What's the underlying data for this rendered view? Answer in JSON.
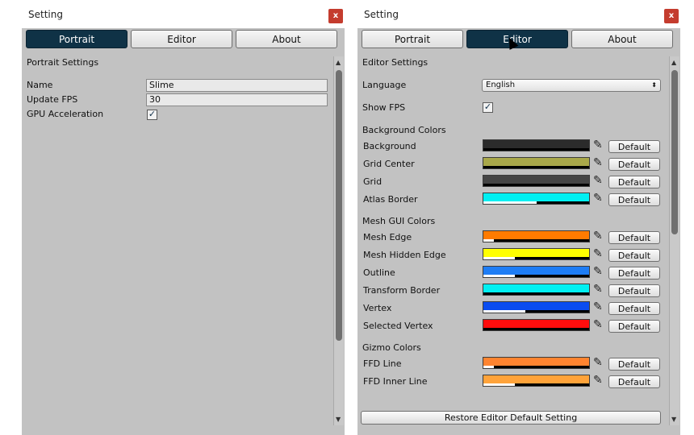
{
  "left": {
    "title": "Setting",
    "close": "x",
    "tabs": [
      "Portrait",
      "Editor",
      "About"
    ],
    "active_tab": "Portrait",
    "section": "Portrait Settings",
    "fields": {
      "name_label": "Name",
      "name_value": "Slime",
      "fps_label": "Update FPS",
      "fps_value": "30",
      "gpu_label": "GPU Acceleration",
      "gpu_checked": true
    },
    "scroll_arrow_up": "▲",
    "scroll_arrow_down": "▼"
  },
  "right": {
    "title": "Setting",
    "close": "x",
    "tabs": [
      "Portrait",
      "Editor",
      "About"
    ],
    "active_tab": "Editor",
    "section": "Editor Settings",
    "language_label": "Language",
    "language_value": "English",
    "show_fps_label": "Show FPS",
    "show_fps_checked": true,
    "bg_group": "Background Colors",
    "mesh_group": "Mesh GUI Colors",
    "gizmo_group": "Gizmo Colors",
    "default_label": "Default",
    "picker_glyph": "✎",
    "colors": [
      {
        "label": "Background",
        "color": "#2b2b2b",
        "alpha": 1.0
      },
      {
        "label": "Grid Center",
        "color": "#a9a84a",
        "alpha": 1.0
      },
      {
        "label": "Grid",
        "color": "#454545",
        "alpha": 1.0
      },
      {
        "label": "Atlas Border",
        "color": "#00f0f2",
        "alpha": 0.5
      },
      {
        "label": "Mesh Edge",
        "color": "#ff7b00",
        "alpha": 0.9
      },
      {
        "label": "Mesh Hidden Edge",
        "color": "#ffff00",
        "alpha": 0.7
      },
      {
        "label": "Outline",
        "color": "#1e7df5",
        "alpha": 0.7
      },
      {
        "label": "Transform Border",
        "color": "#00f0f2",
        "alpha": 1.0
      },
      {
        "label": "Vertex",
        "color": "#0a4cf0",
        "alpha": 0.6
      },
      {
        "label": "Selected Vertex",
        "color": "#ff0d0d",
        "alpha": 1.0
      },
      {
        "label": "FFD Line",
        "color": "#ff8430",
        "alpha": 0.9
      },
      {
        "label": "FFD Inner Line",
        "color": "#ffa33a",
        "alpha": 0.7
      }
    ],
    "restore_label": "Restore Editor Default Setting",
    "scroll_arrow_up": "▲",
    "scroll_arrow_down": "▼"
  }
}
